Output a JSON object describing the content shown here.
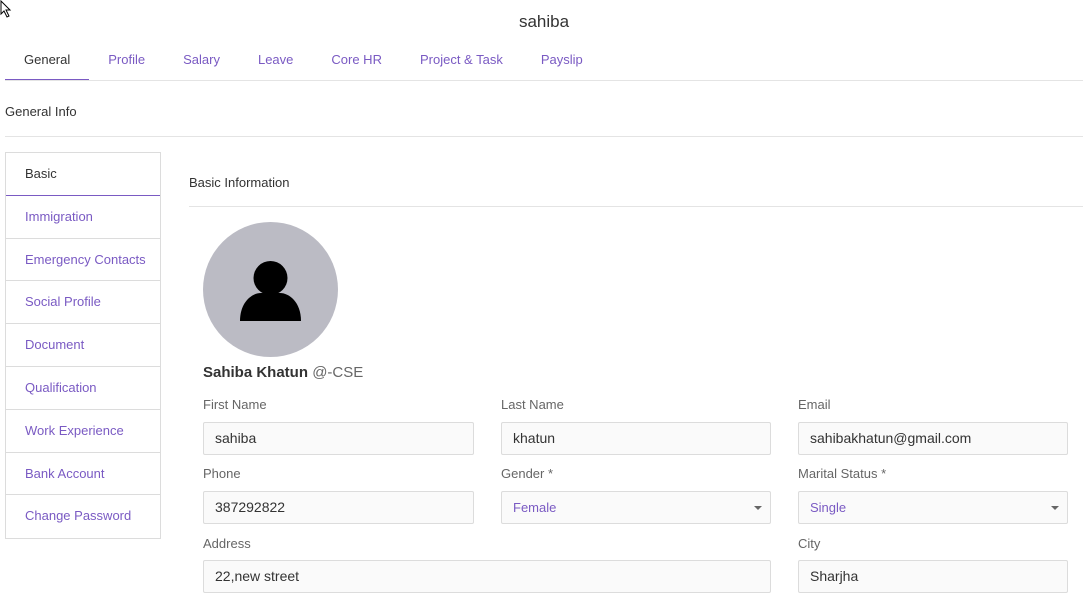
{
  "page": {
    "title": "sahiba"
  },
  "tabs": [
    {
      "label": "General"
    },
    {
      "label": "Profile"
    },
    {
      "label": "Salary"
    },
    {
      "label": "Leave"
    },
    {
      "label": "Core HR"
    },
    {
      "label": "Project & Task"
    },
    {
      "label": "Payslip"
    }
  ],
  "section": {
    "label": "General Info"
  },
  "sidebar": {
    "items": [
      {
        "label": "Basic"
      },
      {
        "label": "Immigration"
      },
      {
        "label": "Emergency Contacts"
      },
      {
        "label": "Social Profile"
      },
      {
        "label": "Document"
      },
      {
        "label": "Qualification"
      },
      {
        "label": "Work Experience"
      },
      {
        "label": "Bank Account"
      },
      {
        "label": "Change Password"
      }
    ]
  },
  "card": {
    "title": "Basic Information"
  },
  "user": {
    "name": "Sahiba Khatun",
    "dept": "@-CSE"
  },
  "form": {
    "first_name": {
      "label": "First Name",
      "value": "sahiba"
    },
    "last_name": {
      "label": "Last Name",
      "value": "khatun"
    },
    "email": {
      "label": "Email",
      "value": "sahibakhatun@gmail.com"
    },
    "phone": {
      "label": "Phone",
      "value": "387292822"
    },
    "gender": {
      "label": "Gender *",
      "value": "Female"
    },
    "marital": {
      "label": "Marital Status *",
      "value": "Single"
    },
    "address": {
      "label": "Address",
      "value": "22,new street"
    },
    "city": {
      "label": "City",
      "value": "Sharjha"
    }
  },
  "colors": {
    "accent": "#7a5ac3",
    "avatar_bg": "#bbbbc4"
  },
  "icons": {
    "avatar": "user-silhouette-icon",
    "cursor": "mouse-pointer-icon",
    "select": "chevron-down-icon"
  }
}
